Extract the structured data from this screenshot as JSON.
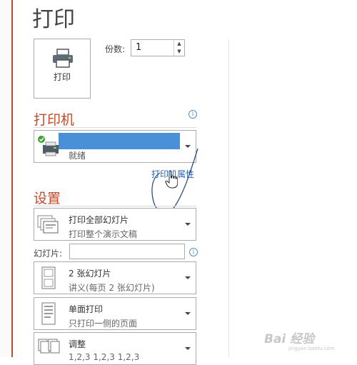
{
  "page": {
    "title": "打印"
  },
  "print_button": {
    "label": "打印",
    "icon": "printer-icon"
  },
  "copies": {
    "label": "份数:",
    "value": "1"
  },
  "printer_section": {
    "heading": "打印机",
    "printer": {
      "name": "",
      "status": "就绪"
    },
    "properties_link": "打印机属性"
  },
  "settings_section": {
    "heading": "设置",
    "print_range": {
      "title": "打印全部幻灯片",
      "subtitle": "打印整个演示文稿"
    },
    "slides": {
      "label": "幻灯片:",
      "value": ""
    },
    "layout": {
      "title": "2 张幻灯片",
      "subtitle": "讲义(每页 2 张幻灯片)"
    },
    "sides": {
      "title": "单面打印",
      "subtitle": "只打印一侧的页面"
    },
    "collation": {
      "title": "调整",
      "subtitle": "1,2,3    1,2,3    1,2,3"
    }
  },
  "watermark": {
    "text": "Bai 经验",
    "sub": "jingyan.baidu.com"
  },
  "colors": {
    "accent": "#c14b2a",
    "link": "#2c67b6",
    "selection": "#4a90d8"
  }
}
